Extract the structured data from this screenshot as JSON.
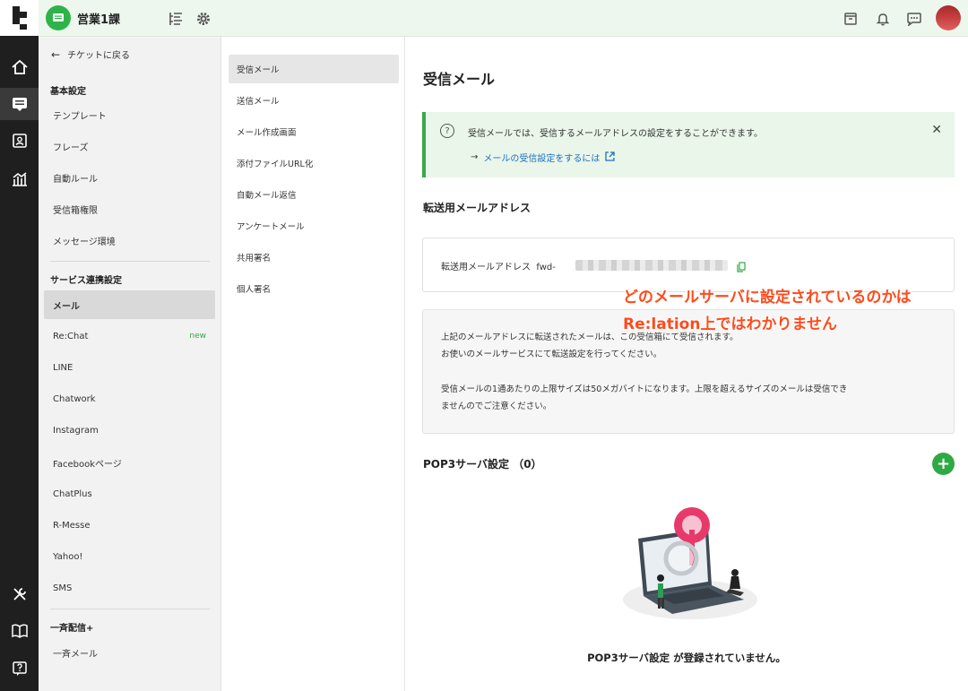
{
  "topbar": {
    "team_name": "営業1課"
  },
  "sidebar": {
    "back_label": "チケットに戻る",
    "section_basic": "基本設定",
    "basic_items": [
      {
        "label": "テンプレート"
      },
      {
        "label": "フレーズ"
      },
      {
        "label": "自動ルール"
      },
      {
        "label": "受信箱権限"
      },
      {
        "label": "メッセージ環境"
      }
    ],
    "section_service": "サービス連携設定",
    "service_items": [
      {
        "label": "メール",
        "active": true
      },
      {
        "label": "Re:Chat",
        "badge": "new"
      },
      {
        "label": "LINE"
      },
      {
        "label": "Chatwork"
      },
      {
        "label": "Instagram"
      },
      {
        "label": "Facebookページ"
      },
      {
        "label": "ChatPlus"
      },
      {
        "label": "R-Messe"
      },
      {
        "label": "Yahoo!"
      },
      {
        "label": "SMS"
      }
    ],
    "section_broadcast": "一斉配信+",
    "broadcast_items": [
      {
        "label": "一斉メール"
      }
    ]
  },
  "submenu": {
    "items": [
      {
        "label": "受信メール",
        "active": true
      },
      {
        "label": "送信メール"
      },
      {
        "label": "メール作成画面"
      },
      {
        "label": "添付ファイルURL化"
      },
      {
        "label": "自動メール返信"
      },
      {
        "label": "アンケートメール"
      },
      {
        "label": "共用署名"
      },
      {
        "label": "個人署名"
      }
    ]
  },
  "main": {
    "title": "受信メール",
    "info": {
      "message": "受信メールでは、受信するメールアドレスの設定をすることができます。",
      "link_arrow": "→",
      "link_text": "メールの受信設定をするには"
    },
    "forward_heading": "転送用メールアドレス",
    "forward_label": "転送用メールアドレス",
    "forward_value_prefix": "fwd-",
    "description": [
      "上記のメールアドレスに転送されたメールは、この受信箱にて受信されます。",
      "お使いのメールサービスにて転送設定を行ってください。",
      "受信メールの1通あたりの上限サイズは50メガバイトになります。上限を超えるサイズのメールは受信でき",
      "ませんのでご注意ください。"
    ],
    "pop3_heading": "POP3サーバ設定 （0）",
    "empty_text": "POP3サーバ設定 が登録されていません。"
  },
  "annotation": {
    "line1": "どのメールサーバに設定されているのかは",
    "line2": "Re:lation上ではわかりません"
  },
  "colors": {
    "accent_green": "#2eaa44",
    "rail_bg": "#1f1f1f",
    "annotation": "#ff4a1c",
    "link": "#1e6fbf"
  }
}
